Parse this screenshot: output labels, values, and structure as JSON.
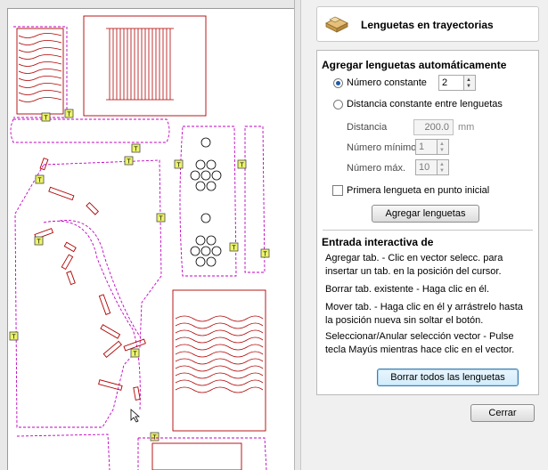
{
  "panel": {
    "title": "Lenguetas en trayectorias",
    "auto_section": {
      "title": "Agregar lenguetas automáticamente",
      "radio_constant_label": "Número constante",
      "constant_value": "2",
      "radio_distance_label": "Distancia constante entre lenguetas",
      "distance_label": "Distancia",
      "distance_value": "200.0",
      "distance_unit": "mm",
      "min_label": "Número mínimo",
      "min_value": "1",
      "max_label": "Número máx.",
      "max_value": "10",
      "first_tab_label": "Primera lengueta en punto inicial",
      "add_button": "Agregar lenguetas"
    },
    "interactive_section": {
      "title": "Entrada interactiva de",
      "add_text": "Agregar tab. - Clic en vector selecc. para insertar un tab. en la posición del cursor.",
      "delete_text": "Borrar tab. existente - Haga clic en él.",
      "move_text": "Mover tab. - Haga clic en él y arrástrelo hasta la posición nueva sin soltar el botón.",
      "select_text": "Seleccionar/Anular selección vector - Pulse tecla Mayús mientras hace clic en el vector.",
      "clear_button": "Borrar todos las lenguetas"
    },
    "close_button": "Cerrar"
  },
  "canvas": {
    "tab_letter": "T",
    "vector_color": "#b00000",
    "toolpath_color": "#c000c0",
    "tab_color": "#ecf46a"
  }
}
